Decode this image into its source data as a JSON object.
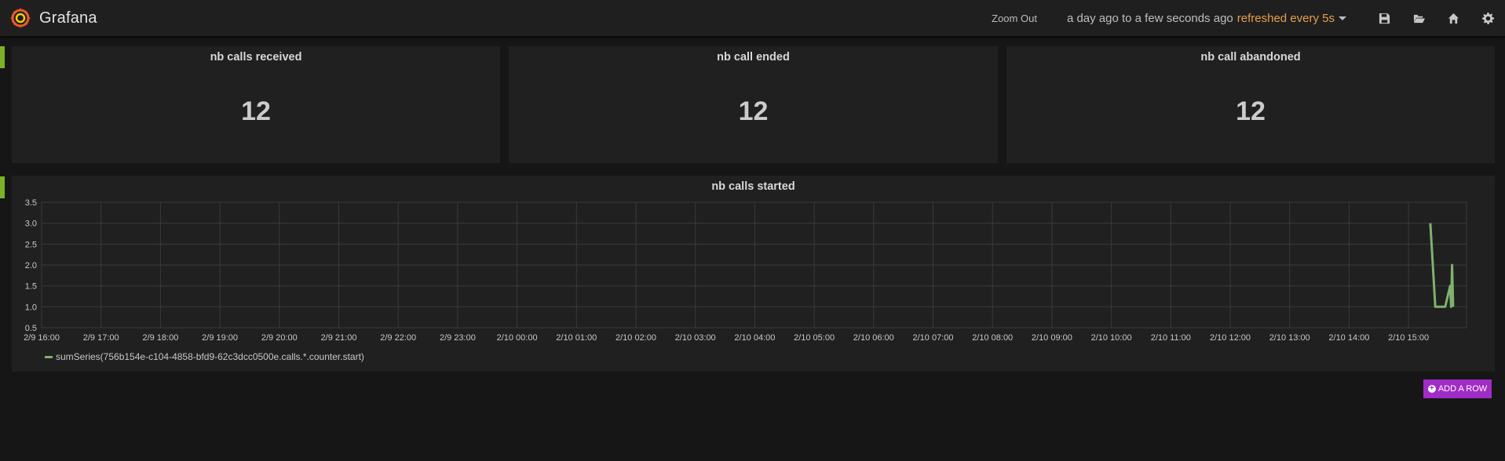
{
  "navbar": {
    "brand": "Grafana",
    "zoom_out": "Zoom Out",
    "time_range": "a day ago to a few seconds ago",
    "refresh": "refreshed every 5s",
    "icons": [
      "save-icon",
      "folder-open-icon",
      "home-icon",
      "gear-icon"
    ]
  },
  "colors": {
    "row_marker": "#7db127",
    "series": "#7eb26d",
    "refresh_text": "#e79f4b",
    "add_row_button": "#a02cc6"
  },
  "stats": [
    {
      "title": "nb calls received",
      "value": "12"
    },
    {
      "title": "nb call ended",
      "value": "12"
    },
    {
      "title": "nb call abandoned",
      "value": "12"
    }
  ],
  "graph": {
    "title": "nb calls started",
    "legend": "sumSeries(756b154e-c104-4858-bfd9-62c3dcc0500e.calls.*.counter.start)"
  },
  "chart_data": {
    "type": "line",
    "title": "nb calls started",
    "xlabel": "",
    "ylabel": "",
    "ylim": [
      0.5,
      3.5
    ],
    "yticks": [
      "3.5",
      "3.0",
      "2.5",
      "2.0",
      "1.5",
      "1.0",
      "0.5"
    ],
    "xticks": [
      "2/9 16:00",
      "2/9 17:00",
      "2/9 18:00",
      "2/9 19:00",
      "2/9 20:00",
      "2/9 21:00",
      "2/9 22:00",
      "2/9 23:00",
      "2/10 00:00",
      "2/10 01:00",
      "2/10 02:00",
      "2/10 03:00",
      "2/10 04:00",
      "2/10 05:00",
      "2/10 06:00",
      "2/10 07:00",
      "2/10 08:00",
      "2/10 09:00",
      "2/10 10:00",
      "2/10 11:00",
      "2/10 12:00",
      "2/10 13:00",
      "2/10 14:00",
      "2/10 15:00"
    ],
    "grid": true,
    "legend_position": "bottom-left",
    "series": [
      {
        "name": "sumSeries(756b154e-c104-4858-bfd9-62c3dcc0500e.calls.*.counter.start)",
        "x": [
          "2/10 15:22",
          "2/10 15:27",
          "2/10 15:37",
          "2/10 15:42",
          "2/10 15:43",
          "2/10 15:44",
          "2/10 15:45"
        ],
        "values": [
          3,
          1,
          1,
          1.5,
          1,
          2,
          1
        ]
      }
    ]
  },
  "buttons": {
    "add_row": "ADD A ROW"
  }
}
